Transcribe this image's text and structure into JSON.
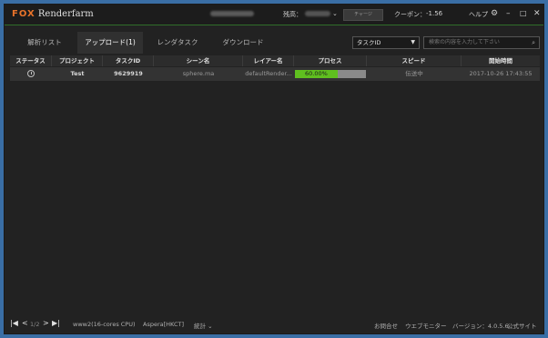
{
  "app": {
    "logo_brand": "FOX",
    "logo_product": "Renderfarm"
  },
  "titlebar": {
    "account_label": "残高：",
    "charge_label": "チャージ",
    "coupon_label": "クーポン：",
    "coupon_value": "-1.56",
    "help_label": "ヘルプ",
    "icons": [
      "gear-icon",
      "minimize-icon",
      "maximize-icon",
      "close-icon"
    ]
  },
  "tabs": [
    {
      "label": "解析リスト",
      "active": false
    },
    {
      "label": "アップロード(1)",
      "active": true
    },
    {
      "label": "レンダタスク",
      "active": false
    },
    {
      "label": "ダウンロード",
      "active": false
    }
  ],
  "filter": {
    "selected": "タスクID",
    "search_placeholder": "検索の内容を入力して下さい"
  },
  "table": {
    "headers": [
      "ステータス",
      "プロジェクト",
      "タスクID",
      "シーン名",
      "レイアー名",
      "プロセス",
      "スピード",
      "開始時間"
    ],
    "rows": [
      {
        "status_icon": "clock-icon",
        "project": "Test",
        "task_id": "9629919",
        "scene": "sphere.ma",
        "layer": "defaultRender...",
        "progress_text": "60.00%",
        "progress_fraction": 0.6,
        "speed": "伝送中",
        "start_time": "2017-10-26 17:43:55"
      }
    ]
  },
  "footer": {
    "first_icon": "first-page-icon",
    "prev_icon": "prev-page-icon",
    "page": "1/2",
    "next_icon": "next-page-icon",
    "last_icon": "last-page-icon",
    "platform": "www2(16-cores CPU)",
    "transfer": "Aspera[HKCT]",
    "stats": "統計",
    "contact": "お問合せ",
    "web_monitor": "ウエブモニター",
    "version": "バージョン：4.0.5.6",
    "website": "公式サイト"
  }
}
